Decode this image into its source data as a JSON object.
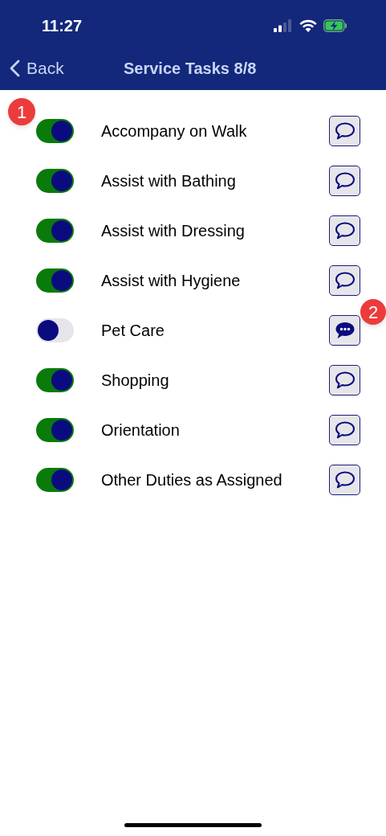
{
  "status_bar": {
    "time": "11:27"
  },
  "nav": {
    "back": "Back",
    "title": "Service Tasks 8/8"
  },
  "tasks": [
    {
      "label": "Accompany on Walk",
      "on": true,
      "has_note": false,
      "toggle_badge": "1"
    },
    {
      "label": "Assist with Bathing",
      "on": true,
      "has_note": false
    },
    {
      "label": "Assist with Dressing",
      "on": true,
      "has_note": false
    },
    {
      "label": "Assist with Hygiene",
      "on": true,
      "has_note": false
    },
    {
      "label": "Pet Care",
      "on": false,
      "has_note": true,
      "note_badge": "2"
    },
    {
      "label": "Shopping",
      "on": true,
      "has_note": false
    },
    {
      "label": "Orientation",
      "on": true,
      "has_note": false
    },
    {
      "label": "Other Duties as Assigned",
      "on": true,
      "has_note": false
    }
  ]
}
